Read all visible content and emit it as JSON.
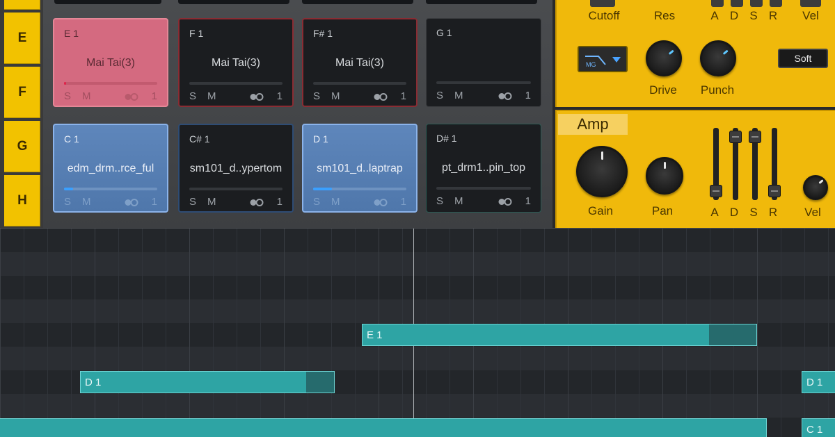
{
  "row_labels": [
    "E",
    "F",
    "G",
    "H"
  ],
  "pads": [
    {
      "note": "E 1",
      "name": "Mai Tai(3)",
      "s": "S",
      "m": "M",
      "count": "1",
      "style": "red",
      "fill": 0.02
    },
    {
      "note": "F 1",
      "name": "Mai Tai(3)",
      "s": "S",
      "m": "M",
      "count": "1",
      "style": "outline-red",
      "fill": 0
    },
    {
      "note": "F# 1",
      "name": "Mai Tai(3)",
      "s": "S",
      "m": "M",
      "count": "1",
      "style": "outline-red",
      "fill": 0
    },
    {
      "note": "G 1",
      "name": "",
      "s": "S",
      "m": "M",
      "count": "1",
      "style": "outline-gray",
      "fill": 0
    },
    {
      "note": "C 1",
      "name": "edm_drm..rce_ful",
      "s": "S",
      "m": "M",
      "count": "1",
      "style": "blue",
      "fill": 0.1
    },
    {
      "note": "C# 1",
      "name": "sm101_d..ypertom",
      "s": "S",
      "m": "M",
      "count": "1",
      "style": "outline-blue",
      "fill": 0
    },
    {
      "note": "D 1",
      "name": "sm101_d..laptrap",
      "s": "S",
      "m": "M",
      "count": "1",
      "style": "blue",
      "fill": 0.2
    },
    {
      "note": "D# 1",
      "name": "pt_drm1..pin_top",
      "s": "S",
      "m": "M",
      "count": "1",
      "style": "outline-teal",
      "fill": 0
    }
  ],
  "filter": {
    "cutoff_label": "Cutoff",
    "res_label": "Res",
    "drive_label": "Drive",
    "punch_label": "Punch",
    "vel_label": "Vel",
    "adsr_labels": [
      "A",
      "D",
      "S",
      "R"
    ],
    "mode_label": "MG",
    "soft_label": "Soft",
    "indicator_color": "#5fc7ff"
  },
  "amp": {
    "title": "Amp",
    "gain_label": "Gain",
    "pan_label": "Pan",
    "vel_label": "Vel",
    "adsr_labels": [
      "A",
      "D",
      "S",
      "R"
    ],
    "adsr_levels": [
      0.05,
      0.95,
      0.95,
      0.05
    ]
  },
  "piano_roll": {
    "notes": [
      {
        "label": "E 1",
        "lane": 4
      },
      {
        "label": "D 1",
        "lane": 6
      },
      {
        "label": "D 1",
        "lane": 6
      },
      {
        "label": "",
        "lane": 8
      },
      {
        "label": "C 1",
        "lane": 8
      }
    ],
    "note_color": "#2ea4a4"
  }
}
